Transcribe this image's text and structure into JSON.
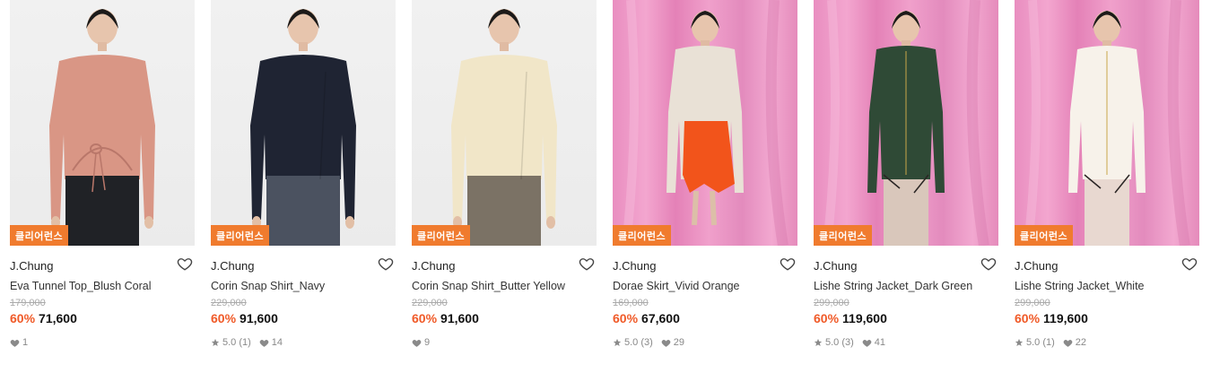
{
  "badge_label": "클리어런스",
  "colors": {
    "badge": "#f07b2e",
    "discount": "#f05a28"
  },
  "products": [
    {
      "brand": "J.Chung",
      "name": "Eva Tunnel Top_Blush Coral",
      "original_price": "179,000",
      "discount": "60%",
      "price": "71,600",
      "rating": "",
      "likes": "1",
      "backdrop": "studio",
      "top_color": "#d99685",
      "bottom_color": "#202226"
    },
    {
      "brand": "J.Chung",
      "name": "Corin Snap Shirt_Navy",
      "original_price": "229,000",
      "discount": "60%",
      "price": "91,600",
      "rating": "5.0 (1)",
      "likes": "14",
      "backdrop": "studio",
      "top_color": "#1f2433",
      "bottom_color": "#4b5260"
    },
    {
      "brand": "J.Chung",
      "name": "Corin Snap Shirt_Butter Yellow",
      "original_price": "229,000",
      "discount": "60%",
      "price": "91,600",
      "rating": "",
      "likes": "9",
      "backdrop": "studio",
      "top_color": "#f1e6c8",
      "bottom_color": "#7b7265"
    },
    {
      "brand": "J.Chung",
      "name": "Dorae Skirt_Vivid Orange",
      "original_price": "169,000",
      "discount": "60%",
      "price": "67,600",
      "rating": "5.0 (3)",
      "likes": "29",
      "backdrop": "pink",
      "top_color": "#e9e1d6",
      "bottom_color": "#f2541b"
    },
    {
      "brand": "J.Chung",
      "name": "Lishe String Jacket_Dark Green",
      "original_price": "299,000",
      "discount": "60%",
      "price": "119,600",
      "rating": "5.0 (3)",
      "likes": "41",
      "backdrop": "pink",
      "top_color": "#2f4a36",
      "bottom_color": "#d9c7bb"
    },
    {
      "brand": "J.Chung",
      "name": "Lishe String Jacket_White",
      "original_price": "299,000",
      "discount": "60%",
      "price": "119,600",
      "rating": "5.0 (1)",
      "likes": "22",
      "backdrop": "pink",
      "top_color": "#f7f2ea",
      "bottom_color": "#e8d8d0"
    }
  ]
}
